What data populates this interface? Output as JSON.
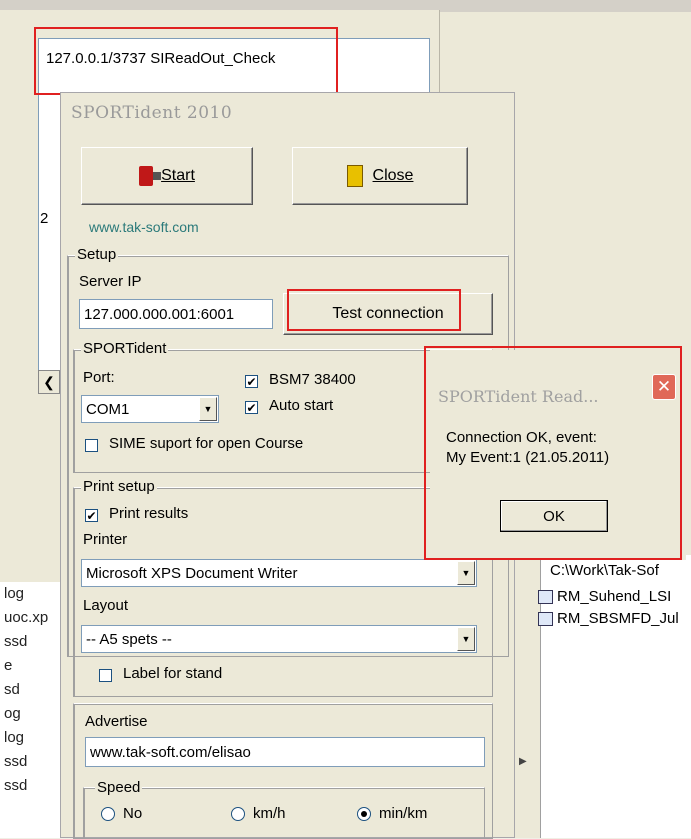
{
  "background": {
    "path_text": "127.0.0.1/3737 SIReadOut_Check",
    "list_partial": "2",
    "left_files": [
      "log",
      "uoc.xp",
      "ssd",
      "e",
      "sd",
      "og",
      "log",
      "ssd",
      "ssd"
    ],
    "right_path": "C:\\Work\\Tak-Sof",
    "right_files": [
      "RM_Suhend_LSI",
      "RM_SBSMFD_Jul"
    ]
  },
  "main": {
    "title": "SPORTident 2010",
    "start_label": "Start",
    "close_label": "Close",
    "link": "www.tak-soft.com",
    "setup": {
      "label": "Setup",
      "server_ip_label": "Server IP",
      "server_ip_value": "127.000.000.001:6001",
      "test_button": "Test connection"
    },
    "sportident": {
      "label": "SPORTident",
      "port_label": "Port:",
      "port_value": "COM1",
      "bsm7_label": "BSM7 38400",
      "bsm7_checked": true,
      "auto_start_label": "Auto start",
      "auto_start_checked": true,
      "sime_label": "SIME suport for open Course",
      "sime_checked": false
    },
    "print": {
      "label": "Print setup",
      "print_results_label": "Print results",
      "print_results_checked": true,
      "printer_label": "Printer",
      "printer_value": "Microsoft XPS Document Writer",
      "layout_label": "Layout",
      "layout_value": "-- A5 spets --",
      "label_for_stand": "Label for stand",
      "label_for_stand_checked": false
    },
    "advertise": {
      "label": "Advertise",
      "value": "www.tak-soft.com/elisao"
    },
    "speed": {
      "label": "Speed",
      "options": [
        "No",
        "km/h",
        "min/km"
      ],
      "selected": "min/km"
    }
  },
  "dialog": {
    "title": "SPORTident Read...",
    "message_line1": "Connection OK, event:",
    "message_line2": "My Event:1 (21.05.2011)",
    "ok_label": "OK"
  },
  "colors": {
    "highlight": "#e02020",
    "window_bg": "#ece9d8",
    "link": "#2b7a7a"
  }
}
